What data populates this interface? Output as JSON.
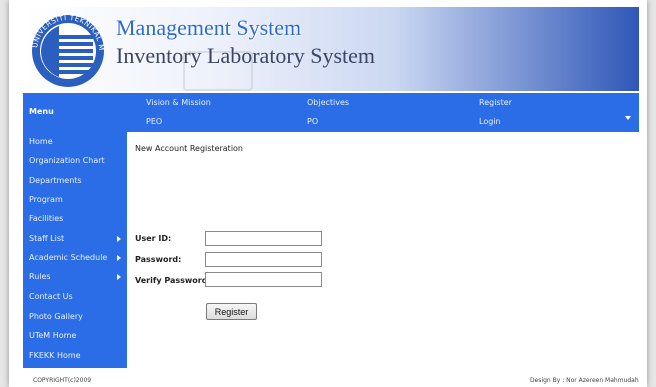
{
  "header": {
    "title_line1": "Management System",
    "title_line2": "Inventory Laboratory System",
    "logo_text": "UNIVERSITI TEKNIKAL MALAYSIA MELAKA"
  },
  "topnav": {
    "menu_label": "Menu",
    "items": [
      {
        "label": "Vision & Mission"
      },
      {
        "label": "Objectives"
      },
      {
        "label": "Register"
      },
      {
        "label": "PEO"
      },
      {
        "label": "PO"
      },
      {
        "label": "Login"
      }
    ]
  },
  "sidebar": {
    "items": [
      {
        "label": "Home"
      },
      {
        "label": "Organization Chart"
      },
      {
        "label": "Departments"
      },
      {
        "label": "Program"
      },
      {
        "label": "Facilities"
      },
      {
        "label": "Staff List"
      },
      {
        "label": "Academic Schedule"
      },
      {
        "label": "Rules"
      },
      {
        "label": "Contact Us"
      },
      {
        "label": "Photo Gallery"
      },
      {
        "label": "UTeM Home"
      },
      {
        "label": "FKEKK Home"
      }
    ]
  },
  "main": {
    "title": "New Account Registeration",
    "form": {
      "user_id_label": "User ID:",
      "user_id_value": "",
      "password_label": "Password:",
      "password_value": "",
      "verify_label": "Verify Password:",
      "verify_value": "",
      "register_button": "Register"
    }
  },
  "footer": {
    "copyright": "COPYRIGHT(c)2009",
    "credit": "Design By : Nor Azereen Mahmudah"
  },
  "colors": {
    "nav_blue": "#2b6de6",
    "title_blue": "#2d6bd2",
    "title_dark": "#3c4663"
  }
}
